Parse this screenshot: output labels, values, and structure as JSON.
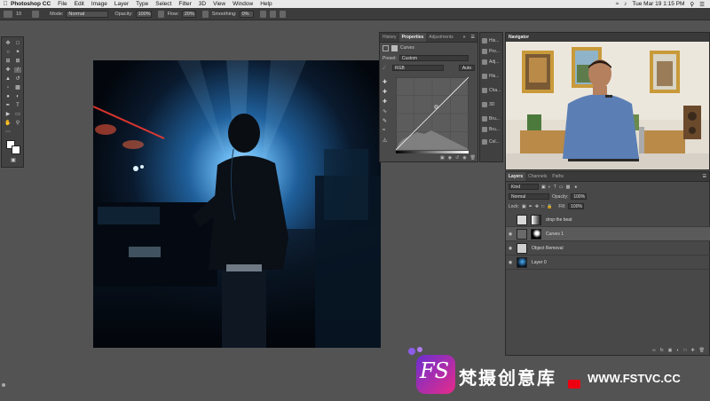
{
  "menubar": {
    "apple": "",
    "items": [
      "Photoshop CC",
      "File",
      "Edit",
      "Image",
      "Layer",
      "Type",
      "Select",
      "Filter",
      "3D",
      "View",
      "Window",
      "Help"
    ],
    "clock": "Tue Mar 19  1:15 PM"
  },
  "options": {
    "brush_size": "10",
    "mode_label": "Mode:",
    "mode_value": "Normal",
    "opacity_label": "Opacity:",
    "opacity_value": "100%",
    "flow_label": "Flow:",
    "flow_value": "20%",
    "smoothing_label": "Smoothing:",
    "smoothing_value": "0%"
  },
  "properties": {
    "tabs": [
      "History",
      "Properties",
      "Adjustments"
    ],
    "active_tab": 1,
    "title": "Curves",
    "preset_label": "Preset:",
    "preset_value": "Custom",
    "channel_value": "RGB",
    "auto_label": "Auto"
  },
  "strip_items": [
    "His...",
    "Pro...",
    "Adj...",
    "His...",
    "Cha...",
    "3D",
    "Bru...",
    "Bru...",
    "Col..."
  ],
  "navigator": {
    "tab": "Navigator"
  },
  "layers": {
    "tabs": [
      "Layers",
      "Channels",
      "Paths"
    ],
    "kind_value": "Kind",
    "blend_value": "Normal",
    "opacity_label": "Opacity:",
    "opacity_value": "100%",
    "lock_label": "Lock:",
    "fill_label": "Fill:",
    "fill_value": "100%",
    "items": [
      {
        "name": "drop the beat",
        "visible": false,
        "selected": false
      },
      {
        "name": "Curves 1",
        "visible": true,
        "selected": true
      },
      {
        "name": "Object Removal",
        "visible": true,
        "selected": false
      },
      {
        "name": "Layer 0",
        "visible": true,
        "selected": false
      }
    ]
  },
  "branding": {
    "logo_text": "FS",
    "chinese": "梵摄创意库",
    "site": "WWW.FSTVC.CC"
  },
  "colors": {
    "canvas_light": "#2f8fd8",
    "logo_pink": "#e62b8a",
    "logo_purple": "#6b2fd0"
  }
}
